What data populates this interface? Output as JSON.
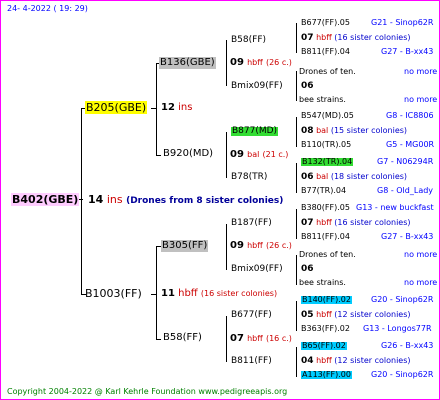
{
  "date": "24-  4-2022 ( 19: 29)",
  "root": {
    "name": "B402(GBE)",
    "gen": "14",
    "ins": "ins",
    "note": "(Drones from 8 sister colonies)"
  },
  "p1": {
    "name": "B205(GBE)",
    "gen": "12",
    "ins": "ins"
  },
  "p2": {
    "name": "B1003(FF)",
    "gen": "11",
    "hbff": "hbff",
    "note": "(16 sister colonies)"
  },
  "gp1": {
    "name": "B136(GBE)",
    "gen": "09",
    "hbff": "hbff",
    "note": "(26 c.)"
  },
  "gp2": {
    "name": "B920(MD)",
    "gen": "09",
    "bal": "bal",
    "note": "(21 c.)"
  },
  "gp3": {
    "name": "B305(FF)",
    "gen": "09",
    "hbff": "hbff",
    "note": "(26 c.)"
  },
  "gp4": {
    "name": "B58(FF)",
    "gen": "07",
    "hbff": "hbff",
    "note": "(16 c.)"
  },
  "ggp": [
    {
      "name": "B58(FF)",
      "gen": "07",
      "kind": "hbff",
      "note": "(16 sister colonies)",
      "top": {
        "name": "B677(FF).05",
        "src": "G21 - Sinop62R"
      },
      "bot": {
        "name": "B811(FF).04",
        "src": "G27 - B-xx43"
      }
    },
    {
      "name": "Bmix09(FF)",
      "gen": "06",
      "kind": "",
      "note": "",
      "top": {
        "name": "Drones of ten.",
        "src": "no more"
      },
      "bot": {
        "name": "bee strains.",
        "src": "no more"
      }
    },
    {
      "name": "B877(MD)",
      "gen": "08",
      "kind": "bal",
      "note": "(15 sister colonies)",
      "top": {
        "name": "B547(MD).05",
        "src": "G8 - IC8806"
      },
      "bot": {
        "name": "B110(TR).05",
        "src": "G5 - MG00R"
      }
    },
    {
      "name": "B78(TR)",
      "gen": "06",
      "kind": "bal",
      "note": "(18 sister colonies)",
      "top": {
        "name": "B132(TR).04",
        "src": "G7 - N06294R"
      },
      "bot": {
        "name": "B77(TR).04",
        "src": "G8 - Old_Lady"
      }
    },
    {
      "name": "B187(FF)",
      "gen": "07",
      "kind": "hbff",
      "note": "(16 sister colonies)",
      "top": {
        "name": "B380(FF).05",
        "src": "G13 - new buckfast"
      },
      "bot": {
        "name": "B811(FF).04",
        "src": "G27 - B-xx43"
      }
    },
    {
      "name": "Bmix09(FF)",
      "gen": "06",
      "kind": "",
      "note": "",
      "top": {
        "name": "Drones of ten.",
        "src": "no more"
      },
      "bot": {
        "name": "bee strains.",
        "src": "no more"
      }
    },
    {
      "name": "B677(FF)",
      "gen": "05",
      "kind": "hbff",
      "note": "(12 sister colonies)",
      "top": {
        "name": "B140(FF).02",
        "src": "G20 - Sinop62R"
      },
      "bot": {
        "name": "B363(FF).02",
        "src": "G13 - Longos77R"
      }
    },
    {
      "name": "B811(FF)",
      "gen": "04",
      "kind": "hbff",
      "note": "(12 sister colonies)",
      "top": {
        "name": "B65(FF).02",
        "src": "G26 - B-xx43"
      },
      "bot": {
        "name": "A113(FF).00",
        "src": "G20 - Sinop62R"
      }
    }
  ],
  "footer": "Copyright 2004-2022 @ Karl Kehrle Foundation    www.pedigreeapis.org"
}
